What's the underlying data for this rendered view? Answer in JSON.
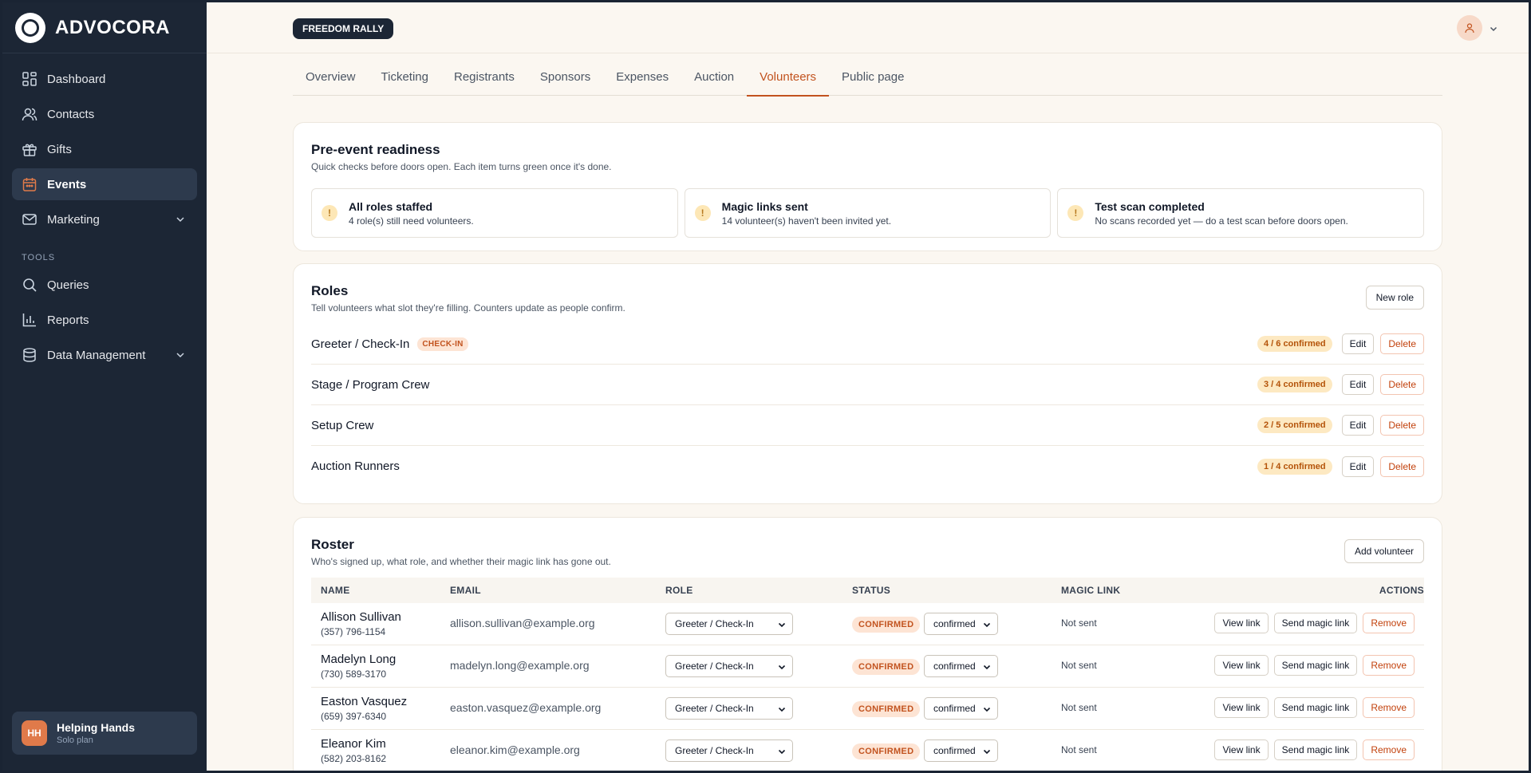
{
  "brand": {
    "name": "ADVOCORA"
  },
  "sidebar": {
    "items": [
      {
        "label": "Dashboard",
        "icon": "dashboard-icon"
      },
      {
        "label": "Contacts",
        "icon": "contacts-icon"
      },
      {
        "label": "Gifts",
        "icon": "gift-icon"
      },
      {
        "label": "Events",
        "icon": "calendar-icon",
        "active": true
      },
      {
        "label": "Marketing",
        "icon": "mail-icon",
        "expandable": true
      }
    ],
    "tools_label": "TOOLS",
    "tools": [
      {
        "label": "Queries",
        "icon": "search-icon"
      },
      {
        "label": "Reports",
        "icon": "bar-chart-icon"
      },
      {
        "label": "Data Management",
        "icon": "database-icon",
        "expandable": true
      }
    ],
    "org": {
      "initials": "HH",
      "name": "Helping Hands",
      "plan": "Solo plan"
    }
  },
  "header": {
    "event_badge": "FREEDOM RALLY"
  },
  "tabs": [
    "Overview",
    "Ticketing",
    "Registrants",
    "Sponsors",
    "Expenses",
    "Auction",
    "Volunteers",
    "Public page"
  ],
  "active_tab": "Volunteers",
  "readiness": {
    "title": "Pre-event readiness",
    "subtitle": "Quick checks before doors open. Each item turns green once it's done.",
    "checks": [
      {
        "title": "All roles staffed",
        "desc": "4 role(s) still need volunteers.",
        "state": "warning"
      },
      {
        "title": "Magic links sent",
        "desc": "14 volunteer(s) haven't been invited yet.",
        "state": "warning"
      },
      {
        "title": "Test scan completed",
        "desc": "No scans recorded yet — do a test scan before doors open.",
        "state": "warning"
      }
    ]
  },
  "roles": {
    "title": "Roles",
    "subtitle": "Tell volunteers what slot they're filling. Counters update as people confirm.",
    "new_role_label": "New role",
    "edit_label": "Edit",
    "delete_label": "Delete",
    "items": [
      {
        "name": "Greeter / Check-In",
        "tag": "CHECK-IN",
        "count": "4 / 6 confirmed"
      },
      {
        "name": "Stage / Program Crew",
        "tag": "",
        "count": "3 / 4 confirmed"
      },
      {
        "name": "Setup Crew",
        "tag": "",
        "count": "2 / 5 confirmed"
      },
      {
        "name": "Auction Runners",
        "tag": "",
        "count": "1 / 4 confirmed"
      }
    ]
  },
  "roster": {
    "title": "Roster",
    "subtitle": "Who's signed up, what role, and whether their magic link has gone out.",
    "add_label": "Add volunteer",
    "columns": {
      "name": "NAME",
      "email": "EMAIL",
      "role": "ROLE",
      "status": "STATUS",
      "magic_link": "MAGIC LINK",
      "actions": "ACTIONS"
    },
    "view_label": "View link",
    "send_label": "Send magic link",
    "remove_label": "Remove",
    "rows": [
      {
        "name": "Allison Sullivan",
        "phone": "(357) 796-1154",
        "email": "allison.sullivan@example.org",
        "role": "Greeter / Check-In",
        "status": "CONFIRMED",
        "status_select": "confirmed",
        "magic_link": "Not sent"
      },
      {
        "name": "Madelyn Long",
        "phone": "(730) 589-3170",
        "email": "madelyn.long@example.org",
        "role": "Greeter / Check-In",
        "status": "CONFIRMED",
        "status_select": "confirmed",
        "magic_link": "Not sent"
      },
      {
        "name": "Easton Vasquez",
        "phone": "(659) 397-6340",
        "email": "easton.vasquez@example.org",
        "role": "Greeter / Check-In",
        "status": "CONFIRMED",
        "status_select": "confirmed",
        "magic_link": "Not sent"
      },
      {
        "name": "Eleanor Kim",
        "phone": "(582) 203-8162",
        "email": "eleanor.kim@example.org",
        "role": "Greeter / Check-In",
        "status": "CONFIRMED",
        "status_select": "confirmed",
        "magic_link": "Not sent"
      }
    ]
  },
  "colors": {
    "accent": "#c2531f",
    "sidebar": "#1c2635",
    "background": "#fbf7f1",
    "warning": "#b7791f"
  }
}
